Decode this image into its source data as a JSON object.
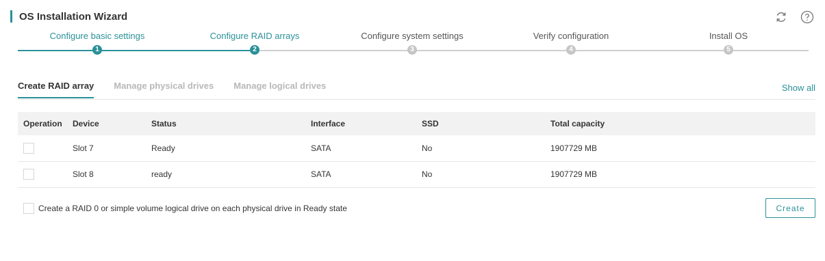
{
  "header": {
    "title": "OS Installation Wizard",
    "icons": [
      "refresh-icon",
      "help-icon"
    ]
  },
  "steps": [
    {
      "num": "1",
      "label": "Configure basic settings",
      "state": "done"
    },
    {
      "num": "2",
      "label": "Configure RAID arrays",
      "state": "current"
    },
    {
      "num": "3",
      "label": "Configure system settings",
      "state": "pending"
    },
    {
      "num": "4",
      "label": "Verify configuration",
      "state": "pending"
    },
    {
      "num": "5",
      "label": "Install OS",
      "state": "pending"
    }
  ],
  "tabs": [
    {
      "label": "Create RAID array",
      "active": true
    },
    {
      "label": "Manage physical drives",
      "active": false
    },
    {
      "label": "Manage logical drives",
      "active": false
    }
  ],
  "show_all": "Show all",
  "table": {
    "columns": [
      "Operation",
      "Device",
      "Status",
      "Interface",
      "SSD",
      "Total capacity"
    ],
    "rows": [
      {
        "checked": false,
        "device": "Slot 7",
        "status": "Ready",
        "interface": "SATA",
        "ssd": "No",
        "capacity": "1907729 MB"
      },
      {
        "checked": false,
        "device": "Slot 8",
        "status": "ready",
        "interface": "SATA",
        "ssd": "No",
        "capacity": "1907729 MB"
      }
    ]
  },
  "footer": {
    "checkbox_label": "Create a RAID 0 or simple volume logical drive on each physical drive in Ready state",
    "checked": false,
    "create_label": "Create"
  },
  "colors": {
    "accent": "#2a9199",
    "inactive": "#c6c6c6",
    "table_header_bg": "#f2f2f2"
  }
}
